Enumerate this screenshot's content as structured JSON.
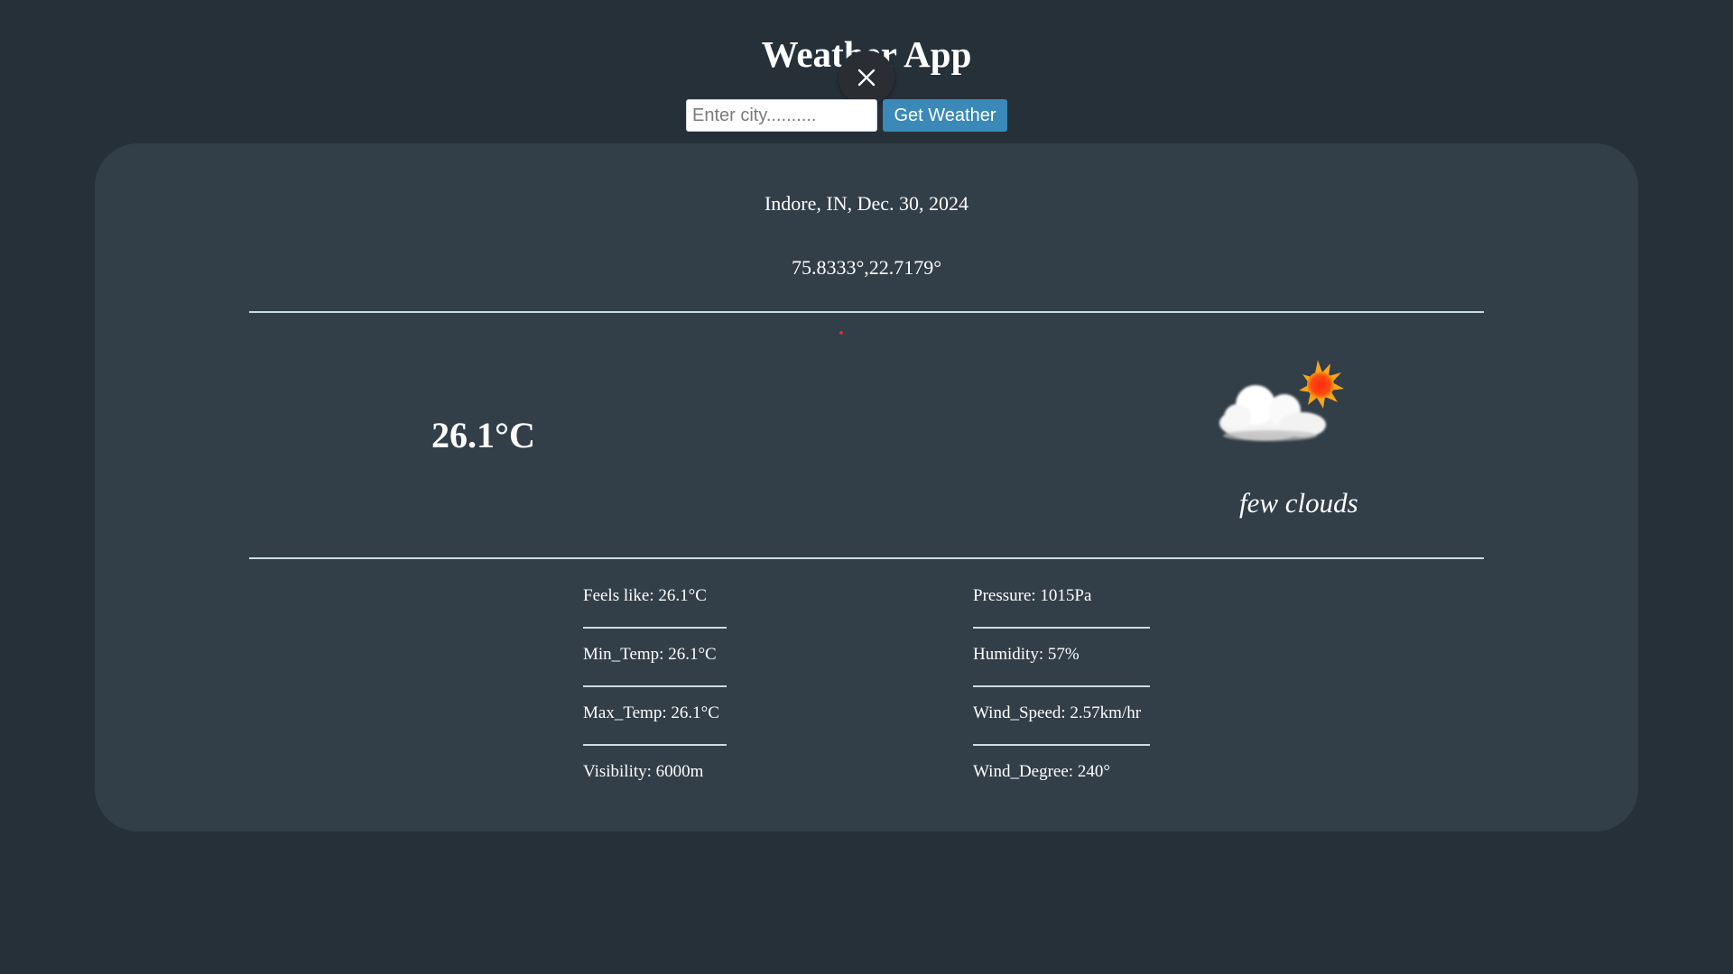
{
  "header": {
    "title": "Weather App"
  },
  "search": {
    "placeholder": "Enter city..........",
    "value": "",
    "button_label": "Get Weather"
  },
  "overlay": {
    "close_icon": "close-icon"
  },
  "weather": {
    "location": "Indore, IN, Dec. 30, 2024",
    "coordinates": "75.8333°,22.7179°",
    "temperature": "26.1°C",
    "icon": "few-clouds-icon",
    "description": "few clouds"
  },
  "details": {
    "left": [
      "Feels like: 26.1°C",
      "Min_Temp: 26.1°C",
      "Max_Temp: 26.1°C",
      "Visibility: 6000m"
    ],
    "right": [
      "Pressure: 1015Pa",
      "Humidity: 57%",
      "Wind_Speed: 2.57km/hr",
      "Wind_Degree: 240°"
    ]
  },
  "colors": {
    "page_bg": "#263039",
    "card_bg": "#323e48",
    "button_bg": "#3a89b8",
    "divider": "#c9dde6"
  }
}
